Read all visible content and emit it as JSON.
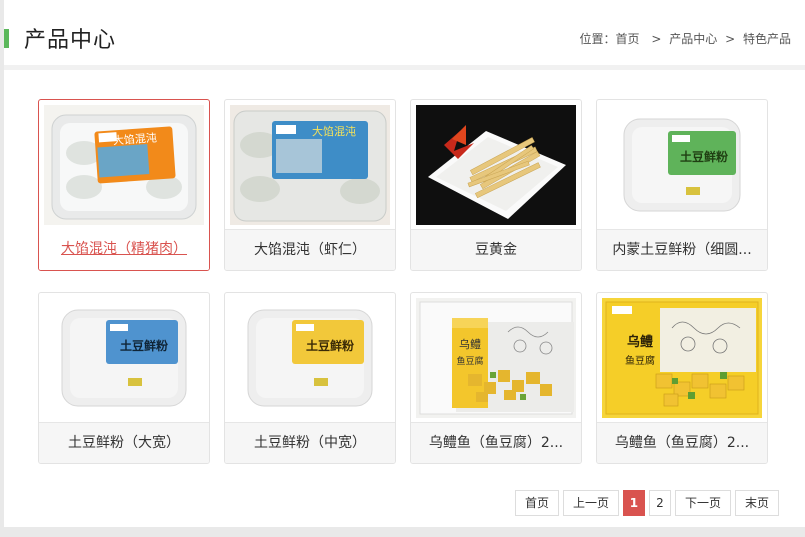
{
  "header": {
    "title": "产品中心",
    "breadcrumb": {
      "prefix": "位置：",
      "items": [
        "首页",
        "产品中心",
        "特色产品"
      ],
      "separator": ">"
    }
  },
  "products": [
    {
      "name": "大馅混沌（精猪肉）",
      "active": true
    },
    {
      "name": "大馅混沌（虾仁）",
      "active": false
    },
    {
      "name": "豆黄金",
      "active": false
    },
    {
      "name": "内蒙土豆鲜粉（细圆...",
      "active": false
    },
    {
      "name": "土豆鲜粉（大宽）",
      "active": false
    },
    {
      "name": "土豆鲜粉（中宽）",
      "active": false
    },
    {
      "name": "乌鳢鱼（鱼豆腐）2...",
      "active": false
    },
    {
      "name": "乌鳢鱼（鱼豆腐）2...",
      "active": false
    }
  ],
  "product_labels": {
    "wonton_pork": "大馅混沌",
    "wonton_shrimp": "大馅混沌",
    "noodle": "土豆鲜粉",
    "fish_line1": "乌鳢",
    "fish_line2": "鱼豆腐"
  },
  "pagination": {
    "first": "首页",
    "prev": "上一页",
    "pages": [
      "1",
      "2"
    ],
    "current": "1",
    "next": "下一页",
    "last": "末页"
  },
  "colors": {
    "accent_green": "#5cb85c",
    "active_red": "#d9534f"
  }
}
